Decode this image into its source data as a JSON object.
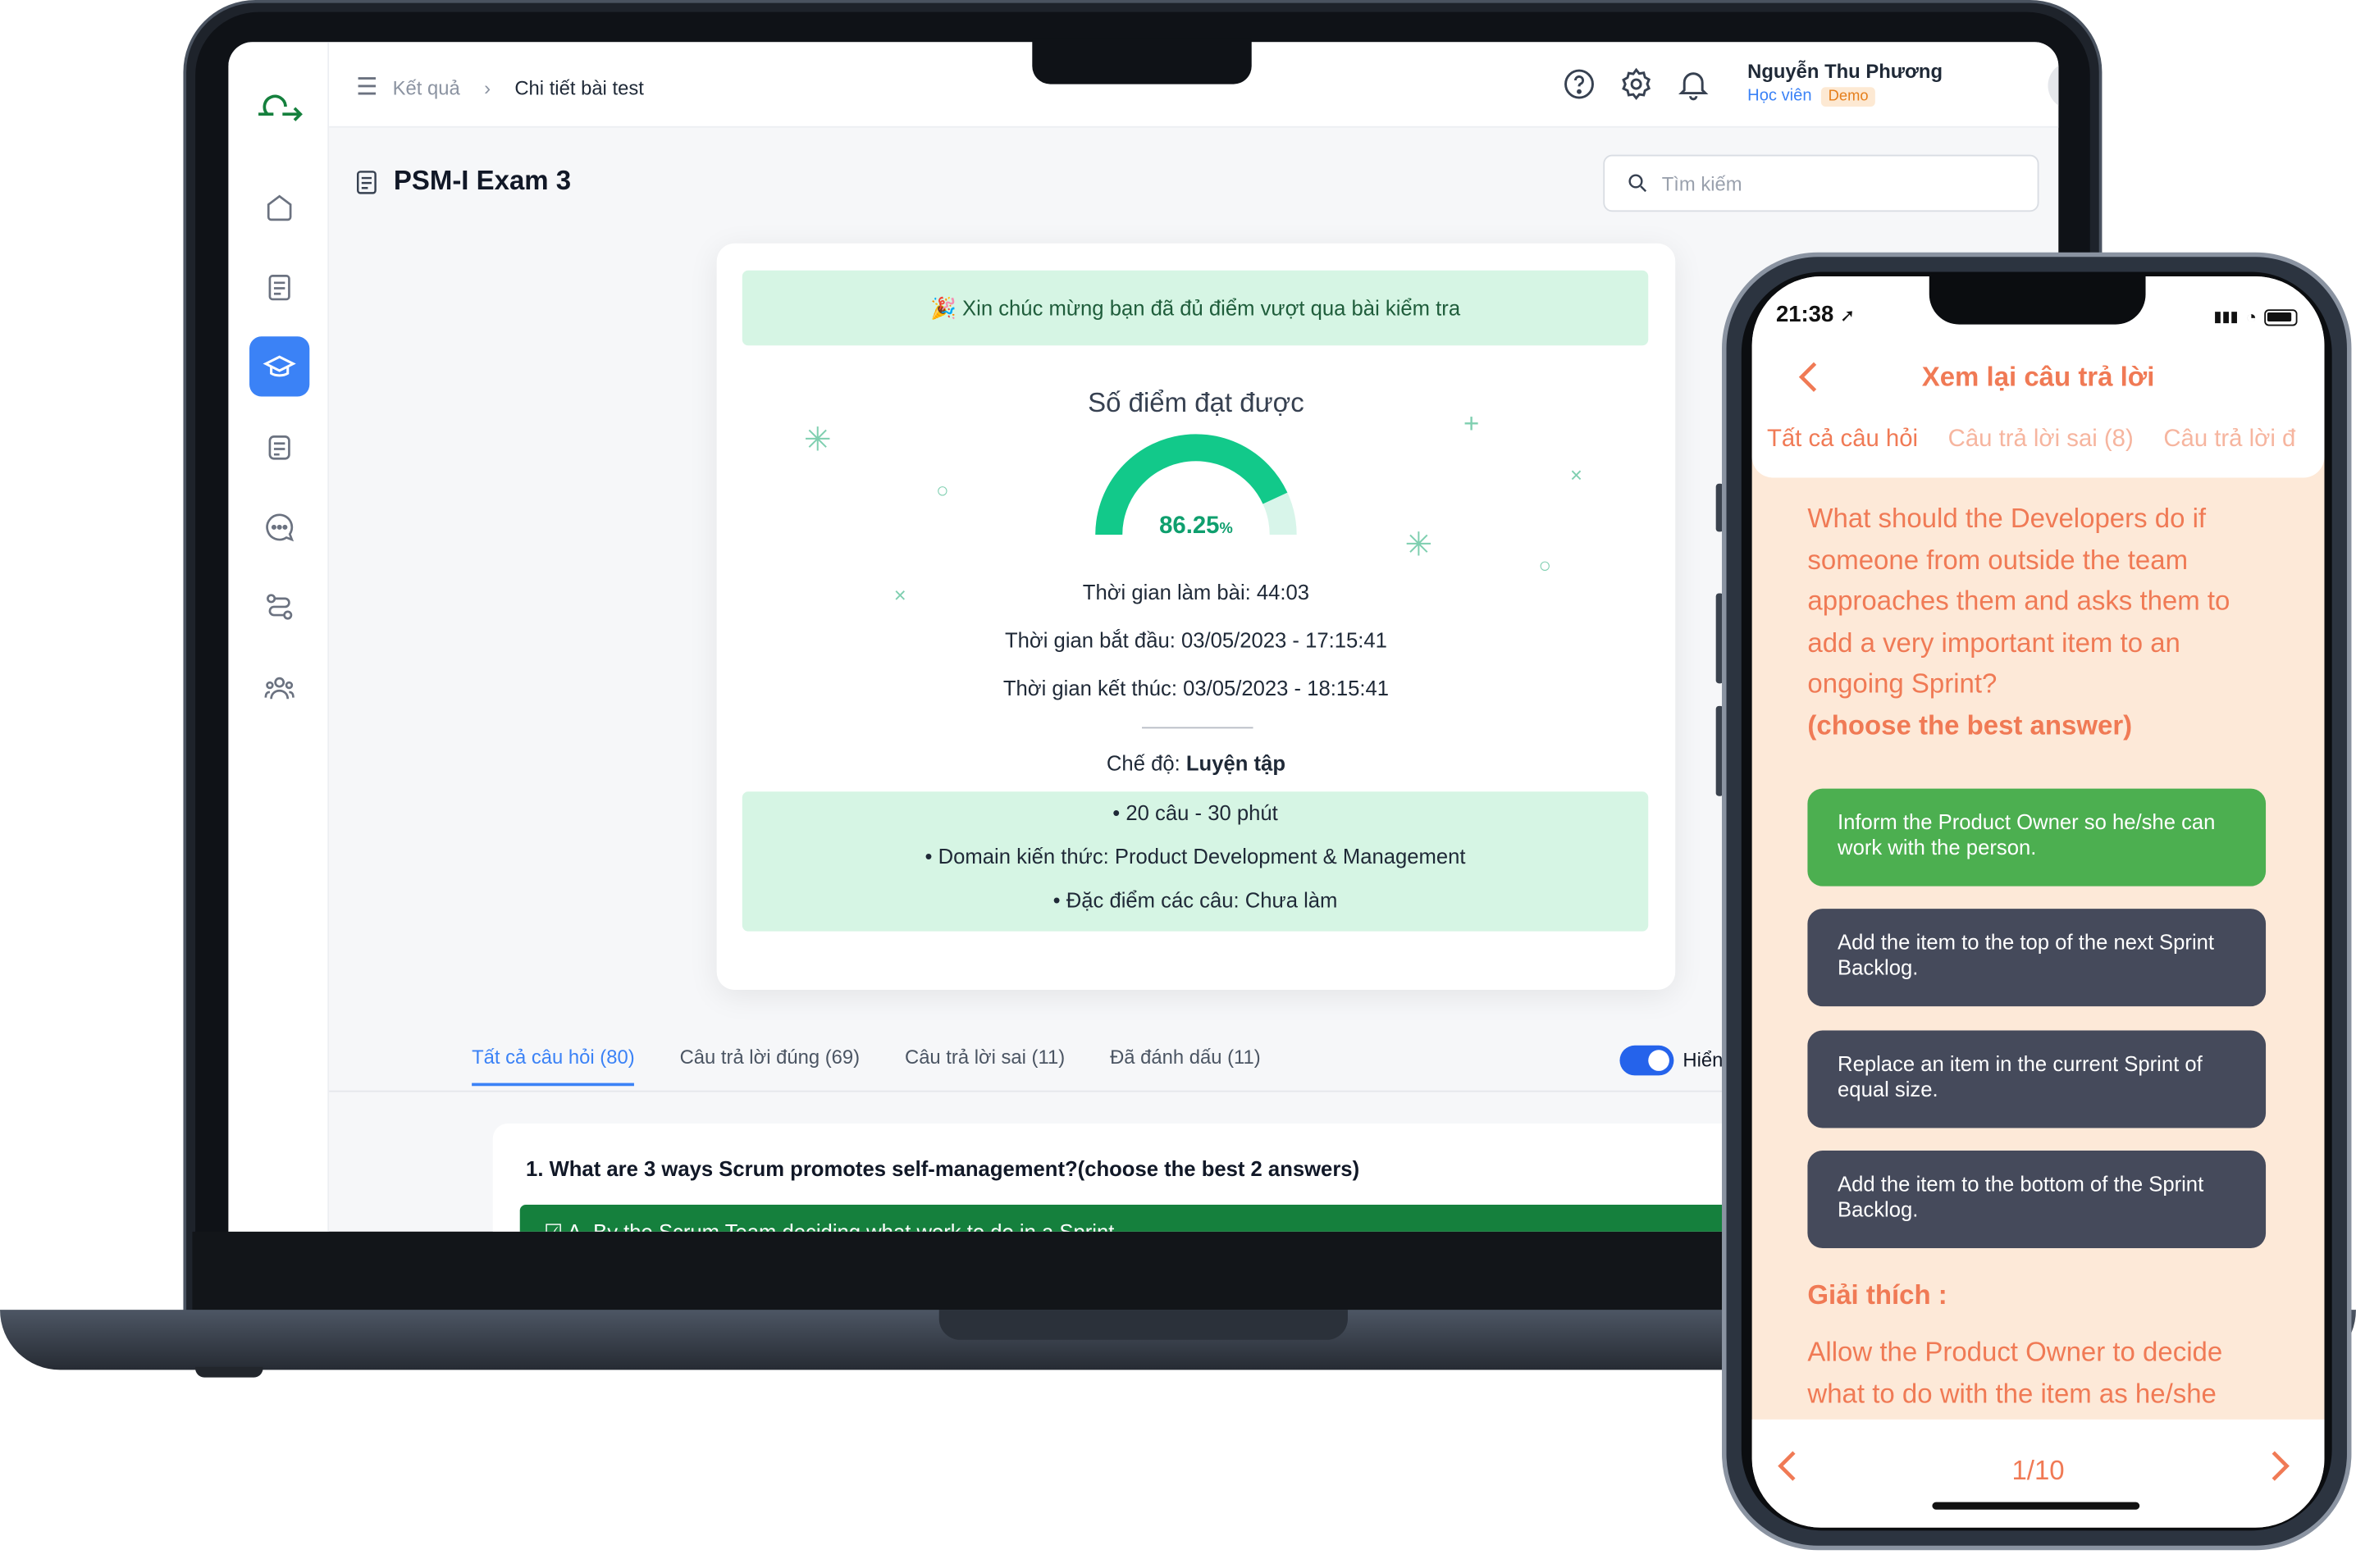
{
  "laptop": {
    "breadcrumb": {
      "parent": "Kết quả",
      "current": "Chi tiết bài test"
    },
    "user": {
      "name": "Nguyễn Thu Phương",
      "role": "Học viên",
      "badge": "Demo"
    },
    "page_title": "PSM-I Exam 3",
    "search_placeholder": "Tìm kiếm",
    "result": {
      "congrats": "🎉 Xin chúc mừng bạn đã đủ điểm vượt qua bài kiểm tra",
      "score_title": "Số điểm đạt được",
      "score_value": "86.25",
      "score_unit": "%",
      "score_fraction": 0.8625,
      "duration": "Thời gian làm bài: 44:03",
      "start": "Thời gian bắt đầu: 03/05/2023 - 17:15:41",
      "end": "Thời gian kết thúc: 03/05/2023 - 18:15:41",
      "mode_label": "Chế độ:",
      "mode_value": "Luyện tập",
      "info": [
        "20 câu - 30 phút",
        "Domain kiến thức: Product Development & Management",
        "Đặc điểm các câu: Chưa làm"
      ]
    },
    "tabs": [
      "Tất cả câu hỏi (80)",
      "Câu trả lời đúng (69)",
      "Câu trả lời sai (11)",
      "Đã đánh dấu (11)"
    ],
    "toggle_label": "Hiển",
    "question": "1. What are 3 ways Scrum promotes self-management?(choose the best 2 answers)",
    "answer_a": "A. By the Scrum Team deciding what work to do in a Sprint.",
    "colors": {
      "primary": "#3b82f6",
      "success_bg": "#d6f5e4",
      "gauge": "#12c98a"
    }
  },
  "phone": {
    "time": "21:38",
    "title": "Xem lại câu trả lời",
    "tabs": [
      "Tất cả câu hỏi",
      "Câu trả lời sai (8)",
      "Câu trả lời đ"
    ],
    "question": "What should the Developers do if someone from outside the team approaches them and asks them to add a very important item to an ongoing Sprint?",
    "question_hint": "(choose the best answer)",
    "options": [
      "Inform the Product Owner so he/she can work with the person.",
      "Add the item to the top of the next Sprint Backlog.",
      "Replace an item in the current Sprint of equal size.",
      "Add the item to the bottom of the Sprint Backlog."
    ],
    "explanation_title": "Giải thích :",
    "explanation": "Allow the Product Owner to decide what to do with the item as he/she",
    "page": "1/10",
    "colors": {
      "accent": "#f07a55",
      "correct": "#4caf50",
      "option": "#454a5b",
      "bg": "#fde9d8"
    }
  }
}
